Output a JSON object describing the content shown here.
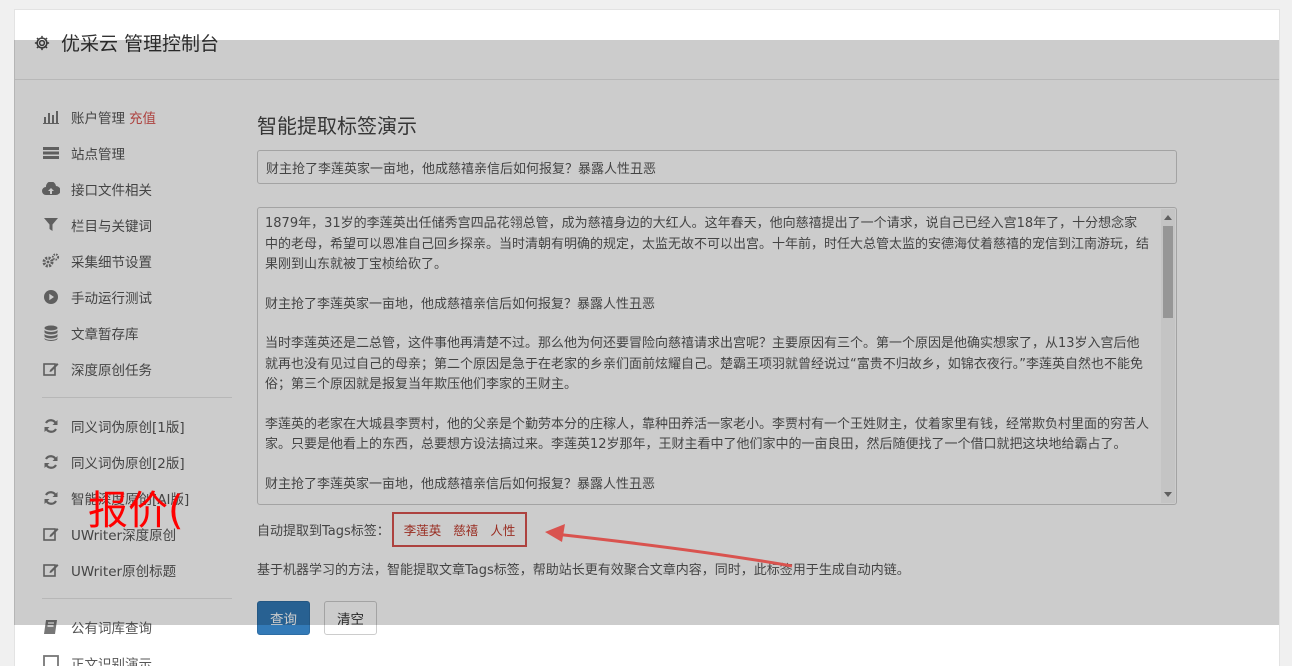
{
  "app": {
    "title": "优采云 管理控制台"
  },
  "sidebar": {
    "group1": [
      {
        "label": "账户管理",
        "extra": "充值",
        "icon": "bar-chart-icon"
      },
      {
        "label": "站点管理",
        "icon": "list-icon"
      },
      {
        "label": "接口文件相关",
        "icon": "cloud-upload-icon"
      },
      {
        "label": "栏目与关键词",
        "icon": "filter-icon"
      },
      {
        "label": "采集细节设置",
        "icon": "cogs-icon"
      },
      {
        "label": "手动运行测试",
        "icon": "play-circle-icon"
      },
      {
        "label": "文章暂存库",
        "icon": "database-icon"
      },
      {
        "label": "深度原创任务",
        "icon": "edit-icon"
      }
    ],
    "group2": [
      {
        "label": "同义词伪原创[1版]",
        "icon": "refresh-icon"
      },
      {
        "label": "同义词伪原创[2版]",
        "icon": "refresh-icon"
      },
      {
        "label": "智能深度原创[AI版]",
        "icon": "refresh-icon"
      },
      {
        "label": "UWriter深度原创",
        "icon": "edit-icon"
      },
      {
        "label": "UWriter原创标题",
        "icon": "edit-icon"
      }
    ],
    "group3": [
      {
        "label": "公有词库查询",
        "icon": "book-icon"
      },
      {
        "label": "正文识别演示",
        "icon": "square-icon"
      }
    ]
  },
  "main": {
    "title": "智能提取标签演示",
    "title_input": "财主抢了李莲英家一亩地，他成慈禧亲信后如何报复？暴露人性丑恶",
    "content_paragraphs": [
      "1879年，31岁的李莲英出任储秀宫四品花翎总管，成为慈禧身边的大红人。这年春天，他向慈禧提出了一个请求，说自己已经入宫18年了，十分想念家中的老母，希望可以恩准自己回乡探亲。当时清朝有明确的规定，太监无故不可以出宫。十年前，时任大总管太监的安德海仗着慈禧的宠信到江南游玩，结果刚到山东就被丁宝桢给砍了。",
      "财主抢了李莲英家一亩地，他成慈禧亲信后如何报复？暴露人性丑恶",
      "当时李莲英还是二总管，这件事他再清楚不过。那么他为何还要冒险向慈禧请求出宫呢？主要原因有三个。第一个原因是他确实想家了，从13岁入宫后他就再也没有见过自己的母亲；第二个原因是急于在老家的乡亲们面前炫耀自己。楚霸王项羽就曾经说过“富贵不归故乡，如锦衣夜行。”李莲英自然也不能免俗；第三个原因就是报复当年欺压他们李家的王财主。",
      "李莲英的老家在大城县李贾村，他的父亲是个勤劳本分的庄稼人，靠种田养活一家老小。李贾村有一个王姓财主，仗着家里有钱，经常欺负村里面的穷苦人家。只要是他看上的东西，总要想方设法搞过来。李莲英12岁那年，王财主看中了他们家中的一亩良田，然后随便找了一个借口就把这块地给霸占了。",
      "财主抢了李莲英家一亩地，他成慈禧亲信后如何报复？暴露人性丑恶"
    ],
    "tags_label": "自动提取到Tags标签：",
    "tags": [
      "李莲英",
      "慈禧",
      "人性"
    ],
    "description": "基于机器学习的方法，智能提取文章Tags标签，帮助站长更有效聚合文章内容，同时，此标签用于生成自动内链。",
    "query_button": "查询",
    "clear_button": "清空"
  },
  "annotation": {
    "text": "报价(",
    "color": "#ff0000"
  }
}
